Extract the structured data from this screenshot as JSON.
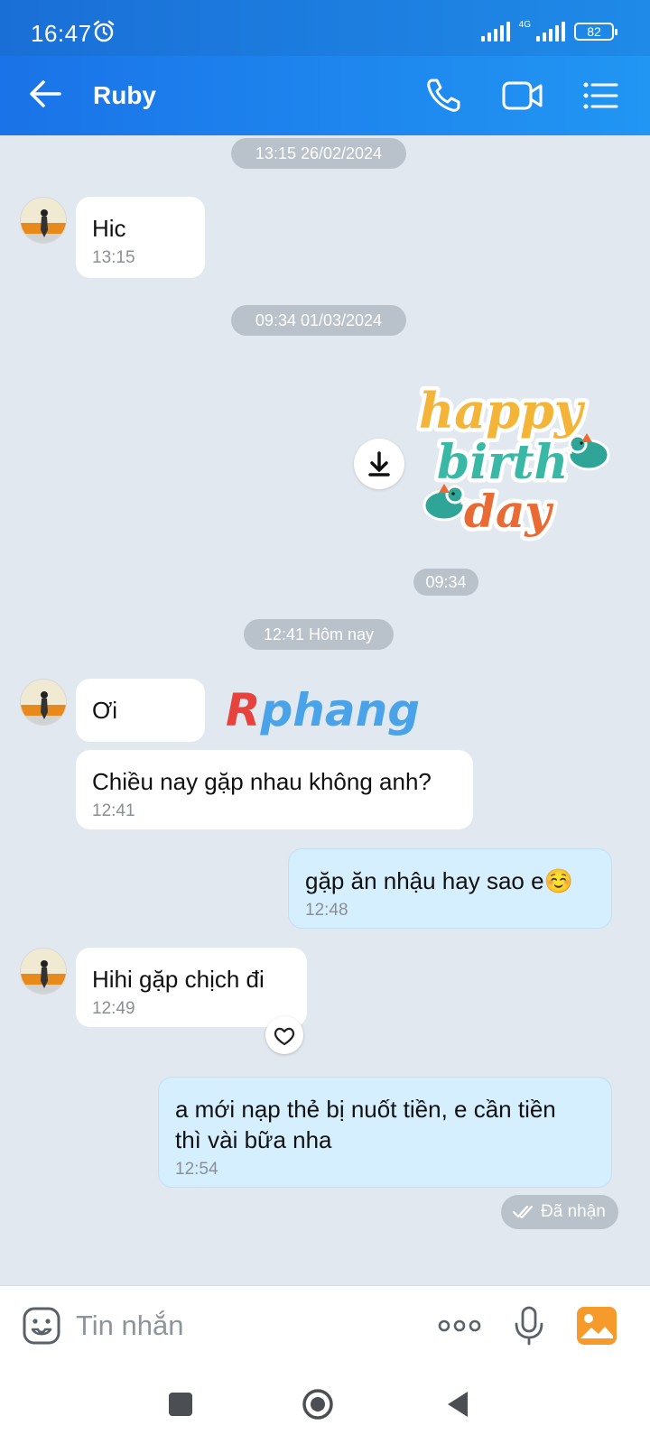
{
  "status": {
    "time": "16:47",
    "network": "4G",
    "battery": "82"
  },
  "header": {
    "contact_name": "Ruby"
  },
  "watermark": "Rphang",
  "date_separators": [
    "13:15 26/02/2024",
    "09:34 01/03/2024",
    "12:41 Hôm nay"
  ],
  "messages": [
    {
      "direction": "in",
      "text": "Hic",
      "time": "13:15"
    },
    {
      "direction": "out",
      "type": "sticker",
      "sticker_text": [
        "happy",
        "birth",
        "day"
      ],
      "time": "09:34"
    },
    {
      "direction": "in",
      "text": "Ơi",
      "time": ""
    },
    {
      "direction": "in",
      "text": "Chiều nay gặp nhau không anh?",
      "time": "12:41"
    },
    {
      "direction": "out",
      "text": "gặp ăn nhậu hay sao e☺️",
      "time": "12:48"
    },
    {
      "direction": "in",
      "text": "Hihi gặp chịch đi",
      "time": "12:49"
    },
    {
      "direction": "out",
      "text_lines": [
        "a mới nạp thẻ bị nuốt tiền, e cần tiền",
        "thì vài bữa nha"
      ],
      "time": "12:54"
    }
  ],
  "delivery_status": "Đã nhận",
  "composer": {
    "placeholder": "Tin nhắn"
  },
  "icons": [
    "alarm-icon",
    "signal-icon",
    "battery-icon",
    "back-arrow-icon",
    "phone-icon",
    "video-call-icon",
    "menu-list-icon",
    "download-icon",
    "heart-icon",
    "double-check-icon",
    "emoji-icon",
    "more-icon",
    "microphone-icon",
    "image-icon",
    "recent-apps-icon",
    "home-icon",
    "back-nav-icon"
  ],
  "colors": {
    "header_blue": "#1a73e8",
    "outgoing_bubble": "#d6efff",
    "incoming_bubble": "#ffffff",
    "background": "#e2e8ef",
    "pill_gray": "#b9c1cb"
  }
}
